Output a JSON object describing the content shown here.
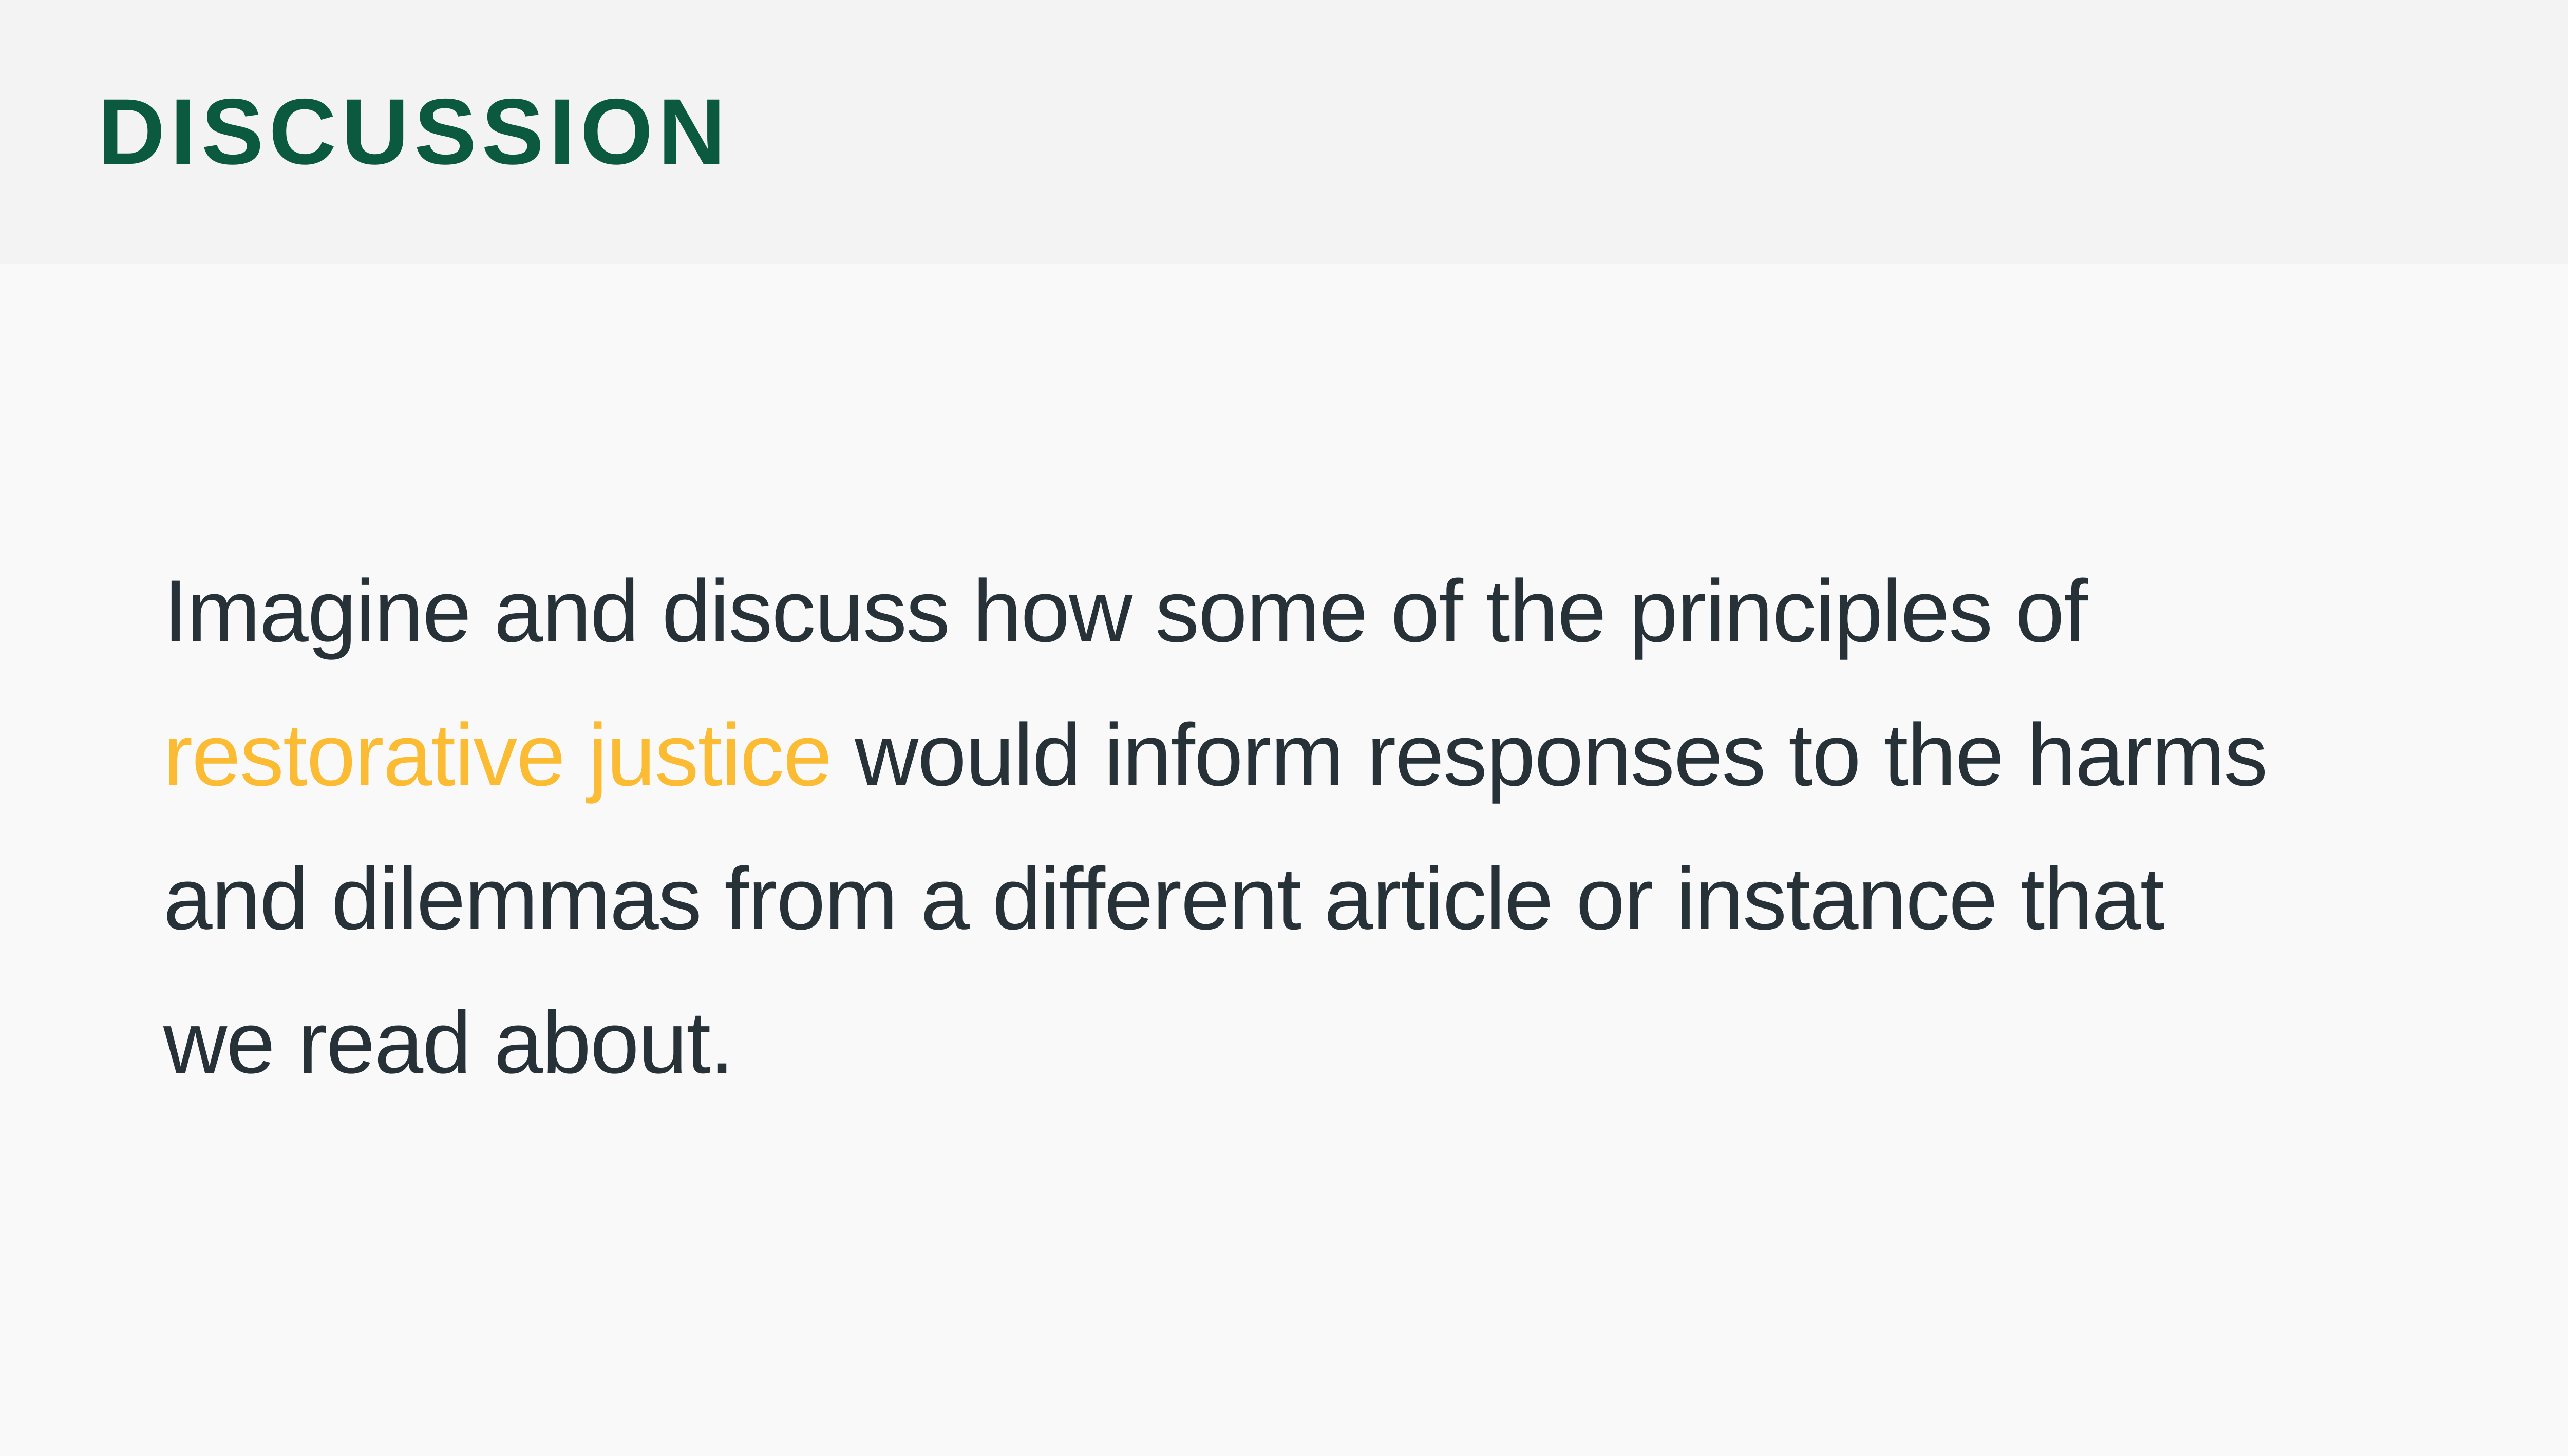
{
  "header": {
    "title": "DISCUSSION"
  },
  "prompt": {
    "line1": "Imagine and discuss how some of the principles of",
    "highlight": "restorative justice",
    "line2_rest": " would inform responses to the harms",
    "line3": "and dilemmas from a different article or instance that",
    "line4": "we read about."
  },
  "colors": {
    "title": "#0b5a3f",
    "text": "#263238",
    "highlight": "#fbbc34",
    "header_bg": "#f3f3f3",
    "page_bg": "#f9f9f9"
  }
}
